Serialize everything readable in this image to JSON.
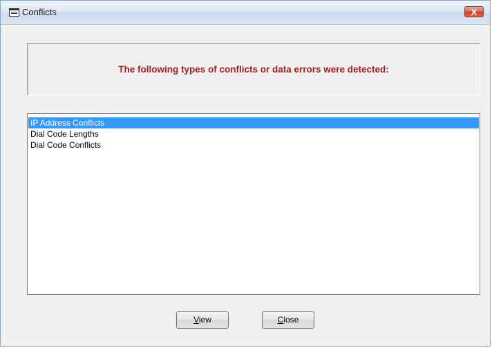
{
  "window": {
    "title": "Conflicts",
    "close_glyph": "X"
  },
  "header": {
    "message": "The following types of conflicts or data errors were detected:"
  },
  "conflict_list": {
    "selected_index": 0,
    "items": [
      "IP Address Conflicts",
      "Dial Code Lengths",
      "Dial Code Conflicts"
    ]
  },
  "buttons": {
    "view_mnemonic": "V",
    "view_rest": "iew",
    "close_mnemonic": "C",
    "close_rest": "lose"
  },
  "colors": {
    "message_text": "#a02020",
    "selection": "#3399ff"
  }
}
